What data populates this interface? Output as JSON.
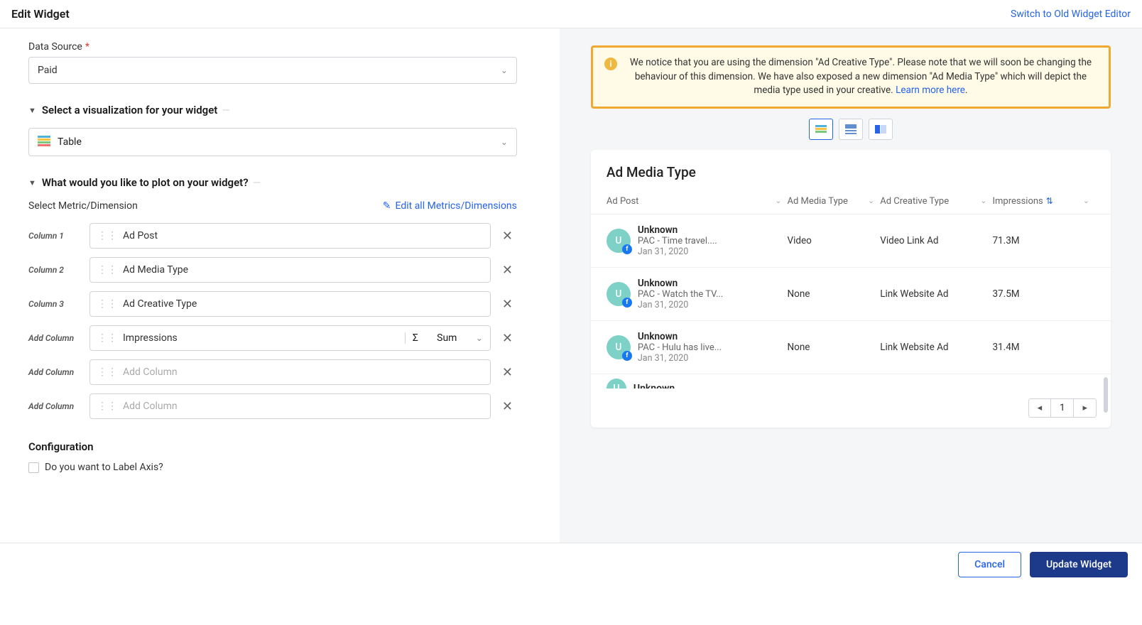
{
  "header": {
    "title": "Edit Widget",
    "switch_link": "Switch to Old Widget Editor"
  },
  "labels": {
    "data_source": "Data Source",
    "section_viz": "Select a visualization for your widget",
    "section_plot": "What would you like to plot on your widget?",
    "select_metric": "Select Metric/Dimension",
    "edit_all": "Edit all Metrics/Dimensions",
    "config": "Configuration",
    "label_axis": "Do you want to Label Axis?"
  },
  "data_source_value": "Paid",
  "visualization_value": "Table",
  "columns": [
    {
      "label": "Column 1",
      "value": "Ad Post",
      "placeholder": "",
      "agg": ""
    },
    {
      "label": "Column 2",
      "value": "Ad Media Type",
      "placeholder": "",
      "agg": ""
    },
    {
      "label": "Column 3",
      "value": "Ad Creative Type",
      "placeholder": "",
      "agg": ""
    },
    {
      "label": "Add Column",
      "value": "Impressions",
      "placeholder": "",
      "agg": "Sum"
    },
    {
      "label": "Add Column",
      "value": "",
      "placeholder": "Add Column",
      "agg": ""
    },
    {
      "label": "Add Column",
      "value": "",
      "placeholder": "Add Column",
      "agg": ""
    }
  ],
  "alert": {
    "text_before": "We notice that you are using the dimension \"Ad Creative Type\". Please note that we will soon be changing the behaviour of this dimension. We have also exposed a new dimension \"Ad Media Type\" which will depict the media type used in your creative. ",
    "link": "Learn more here"
  },
  "preview": {
    "title": "Ad Media Type",
    "headers": {
      "h1": "Ad Post",
      "h2": "Ad Media Type",
      "h3": "Ad Creative Type",
      "h4": "Impressions"
    },
    "rows": [
      {
        "name": "Unknown",
        "sub": "PAC - Time travel....",
        "date": "Jan 31, 2020",
        "media": "Video",
        "creative": "Video Link Ad",
        "impr": "71.3M"
      },
      {
        "name": "Unknown",
        "sub": "PAC - Watch the TV...",
        "date": "Jan 31, 2020",
        "media": "None",
        "creative": "Link Website Ad",
        "impr": "37.5M"
      },
      {
        "name": "Unknown",
        "sub": "PAC - Hulu has live...",
        "date": "Jan 31, 2020",
        "media": "None",
        "creative": "Link Website Ad",
        "impr": "31.4M"
      }
    ],
    "clipped": "Unknown",
    "avatar_letter": "U",
    "page": "1"
  },
  "footer": {
    "cancel": "Cancel",
    "update": "Update Widget"
  },
  "sigma": "Σ"
}
